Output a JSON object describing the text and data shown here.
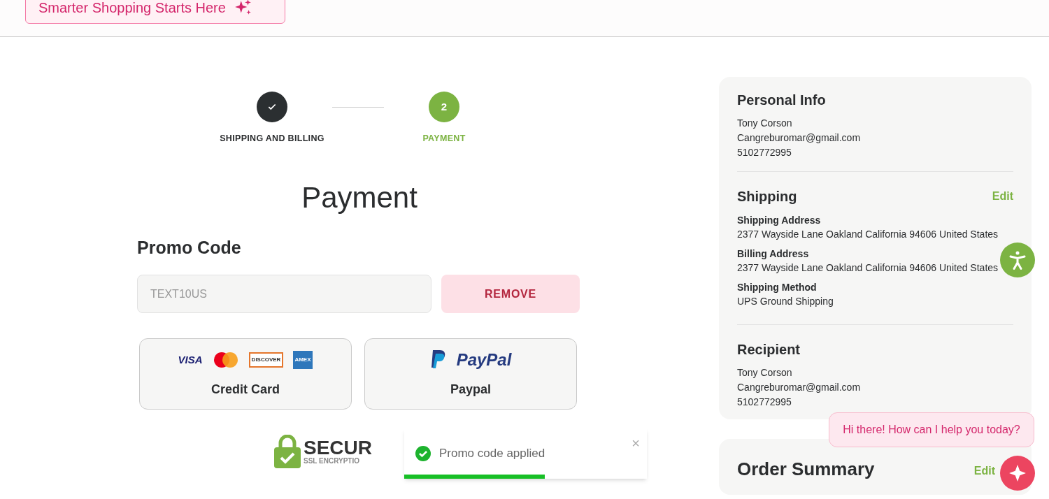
{
  "banner": {
    "label": "Smarter Shopping Starts Here"
  },
  "stepper": [
    {
      "label": "SHIPPING AND BILLING",
      "done": true,
      "selected": false
    },
    {
      "label": "PAYMENT",
      "number": "2",
      "done": false,
      "selected": true
    }
  ],
  "title": "Payment",
  "promo": {
    "heading": "Promo Code",
    "value": "TEXT10US",
    "disabled": true,
    "button": "REMOVE"
  },
  "payment_methods": [
    {
      "kind": "card",
      "label": "Credit Card",
      "logos": [
        {
          "kind": "visa",
          "text": "VISA"
        },
        {
          "kind": "mastercard"
        },
        {
          "kind": "discover",
          "text": "DISCOVER"
        },
        {
          "kind": "amex",
          "text": "AMEX"
        }
      ]
    },
    {
      "kind": "paypal",
      "label": "Paypal",
      "logos": [
        "PayPal"
      ]
    }
  ],
  "secure_badge": {
    "title": "SECUR",
    "subtitle": "SSL ENCRYPTIO"
  },
  "toast": {
    "message": "Promo code applied",
    "close": "×",
    "level": 0.58
  },
  "sidebar": {
    "sections": [
      {
        "title": "Personal Info",
        "lines": [
          {
            "text": "Tony Corson"
          },
          {
            "text": "Cangreburomar@gmail.com"
          },
          {
            "text": "5102772995"
          }
        ]
      },
      {
        "title": "Shipping",
        "edit": "Edit",
        "fields": [
          {
            "label": "Shipping Address",
            "value": "2377 Wayside Lane Oakland California 94606 United States"
          },
          {
            "label": "Billing Address",
            "value": "2377 Wayside Lane Oakland California 94606 United States"
          },
          {
            "label": "Shipping Method",
            "value": "UPS Ground Shipping"
          }
        ]
      },
      {
        "title": "Recipient",
        "lines": [
          {
            "text": "Tony Corson"
          },
          {
            "text": "Cangreburomar@gmail.com"
          },
          {
            "text": "5102772995"
          }
        ]
      }
    ],
    "order_summary": {
      "title": "Order Summary",
      "edit": "Edit"
    }
  },
  "chat": {
    "greeting": "Hi there! How can I help you today?"
  }
}
